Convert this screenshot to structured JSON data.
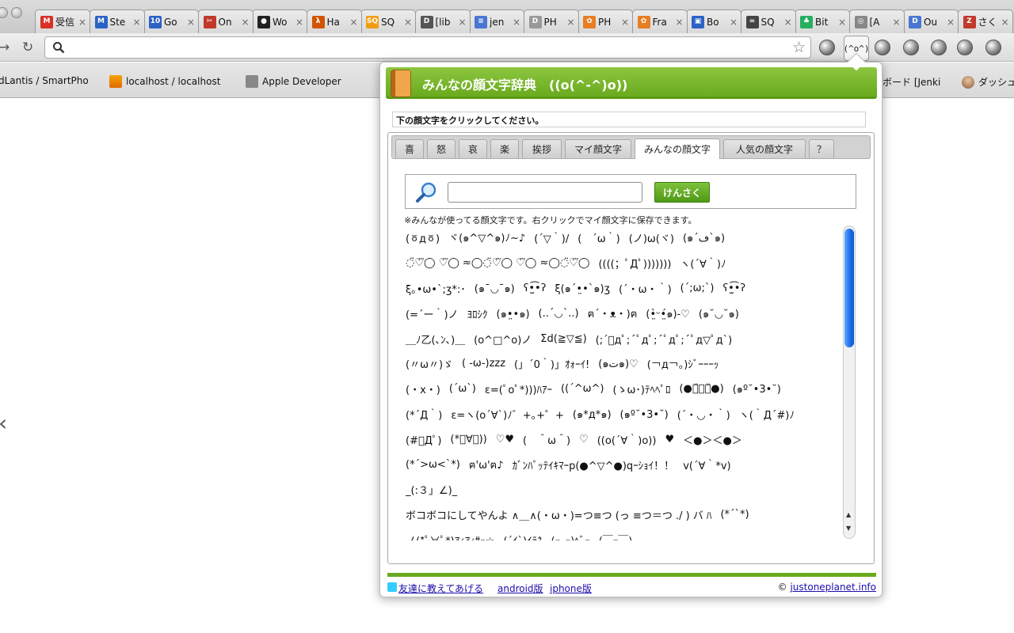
{
  "tabs": [
    {
      "label": "受信",
      "fav": "M",
      "fav_color": "#d93025"
    },
    {
      "label": "Ste",
      "fav": "M",
      "fav_color": "#2a63c4"
    },
    {
      "label": "Go",
      "fav": "10",
      "fav_color": "#2a63c4"
    },
    {
      "label": "On",
      "fav": "✂",
      "fav_color": "#c0392b"
    },
    {
      "label": "Wo",
      "fav": "●",
      "fav_color": "#222222"
    },
    {
      "label": "Ha",
      "fav": "λ",
      "fav_color": "#d35400"
    },
    {
      "label": "SQ",
      "fav": "SQ",
      "fav_color": "#f39c12"
    },
    {
      "label": "[lib",
      "fav": "D",
      "fav_color": "#555555"
    },
    {
      "label": "jen",
      "fav": "≡",
      "fav_color": "#4a76d1"
    },
    {
      "label": "PH",
      "fav": "D",
      "fav_color": "#999999"
    },
    {
      "label": "PH",
      "fav": "✿",
      "fav_color": "#e67e22"
    },
    {
      "label": "Fra",
      "fav": "✿",
      "fav_color": "#e67e22"
    },
    {
      "label": "Bo",
      "fav": "▣",
      "fav_color": "#2a63c4"
    },
    {
      "label": "SQ",
      "fav": "∞",
      "fav_color": "#444444"
    },
    {
      "label": "Bit",
      "fav": "♣",
      "fav_color": "#27ae60"
    },
    {
      "label": "[A",
      "fav": "◎",
      "fav_color": "#888888"
    },
    {
      "label": "Ou",
      "fav": "D",
      "fav_color": "#4a76d1"
    },
    {
      "label": "さく",
      "fav": "Z",
      "fav_color": "#c0392b"
    }
  ],
  "omnibox": {
    "value": "",
    "placeholder": ""
  },
  "extension_active_label": "(^o^)",
  "bookmarks": [
    {
      "label": "dLantis / SmartPho"
    },
    {
      "label": "localhost / localhost"
    },
    {
      "label": "Apple Developer"
    },
    {
      "label": "ボード [Jenki"
    },
    {
      "label": "ダッシュ"
    }
  ],
  "popup": {
    "title": "みんなの顔文字辞典　((o(^-^)o))",
    "instruction": "下の顔文字をクリックしてください。",
    "tabs": [
      "喜",
      "怒",
      "哀",
      "楽",
      "挨拶",
      "マイ顔文字",
      "みんなの顔文字",
      "人気の顔文字",
      "？"
    ],
    "active_tab": 6,
    "search_button": "けんさく",
    "search_value": "",
    "note": "※みんなが使ってる顔文字です。右クリックでマイ顔文字に保存できます。",
    "kaomoji_rows": [
      [
        "(ㆆдㆆ)",
        "ヾ(๑^▽^๑)ﾉ~♪",
        "(´▽｀)/",
        "(　´ω｀)",
        "(ノ)ω(ヾ)",
        "(๑´ڡ`๑)"
      ],
      [
        "◌̈♡⃛◯ ♡⃛◯ ≈◯◌̈♡⃛◯ ♡⃛◯ ≈◯◌̈♡⃛◯",
        "((((；ﾟДﾟ)))))))",
        "ヽ(´∀｀)ﾉ"
      ],
      [
        "ξ｡•ω•`;ʒ*:･",
        "(๑¯◡¯๑)",
        "ʕ•̫͡•ʔ",
        "ξ(๑´•̤•`๑)ʒ",
        "(´・ω・｀)",
        "(´;ω;`)",
        "ʕ•̫͡•ʔ"
      ],
      [
        "(=´ー｀)ノ",
        "ﾖﾛｼｸ",
        "(๑•̤•๑)",
        "(..´◡`..)",
        "ฅ´・ᴥ・)ฅ",
        "(•̤̀ᵕ•̤́๑)-♡",
        "(๑˘◡˘๑)"
      ],
      [
        "＿ﾉ乙(､ﾝ､)＿",
        "(o^□^o)ノ",
        "Σd(≧▽≦)",
        "(;´ﾟдﾟ;´ﾟдﾟ;´ﾟдﾟ;´ﾟд▽ﾟд`)"
      ],
      [
        "(〃ω〃)ゞ",
        "( -ω-)zzz",
        "(」´0｀)」ｵｫｰｲ!",
        "(๑ت๑)♡",
        "(￢д￢。)ｼﾞｰｰｰｯ"
      ],
      [
        "(・x・)",
        "(´ω`)",
        "ε=(ﾟoﾟ*)))ﾊｱｰ",
        "((´^ω^)",
        "(ゝω･)ﾃﾍﾍﾟﾛ",
        "(●・̆⍛・̆●)",
        "(๑º˘•3•˘)"
      ],
      [
        "(*´Д｀)",
        "ε=ヽ(o´∀`)ﾉ゛+｡+゜+",
        "(๑*д*๑)",
        "(๑º˘•3•˘)",
        "(´・◡・｀)",
        "ヽ(｀Д´#)ﾉ"
      ],
      [
        "(#ﾟДﾟ)",
        "(*ﾟ∀ﾟ))",
        "♡♥",
        "(　＾ω＾)",
        "♡",
        "((o(´∀｀)o))",
        "♥",
        "＜●＞＜●＞"
      ],
      [
        "(*´>ω<`*)",
        "ฅ'ω'ฅ♪",
        "ｶﾞﾝﾊﾞｯﾃｲｷﾏｰp(●^▽^●)qｰｼｮｲ！！",
        "v(´∀｀*v)"
      ],
      [
        "_(:３」∠)_"
      ],
      [
        "ボコボコにしてやんよ ∧＿∧(・ω・)=つ≡つ (っ ≡つ＝つ ./ ) バ ﾊ",
        "(*´`*)"
      ],
      [
        "ノ(*ﾟ∀ﾟ*)ｱｨｱｨｻｰ☆",
        "(´ｲ`)ｲﾗﾈ",
        "(ｰ_ｰ)ﾍﾞｰ",
        "(￣ｰ￣)"
      ]
    ],
    "footer": {
      "tweet_label": "友達に教えてあげる",
      "android_label": "android版",
      "iphone_label": "iphone版",
      "copyright": "©",
      "site_link": "justoneplanet.info"
    }
  },
  "colors": {
    "accent_green": "#6aaa1e",
    "scroll_blue": "#1c6fe8",
    "link": "#1a0dab"
  }
}
